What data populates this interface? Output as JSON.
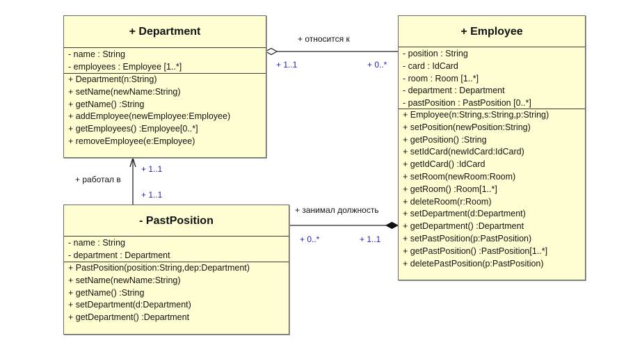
{
  "classes": {
    "department": {
      "name": "+ Department",
      "attributes": [
        "- name : String",
        "- employees : Employee [1..*]"
      ],
      "operations": [
        "+ Department(n:String)",
        "+ setName(newName:String)",
        "+ getName() :String",
        "+ addEmployee(newEmployee:Employee)",
        "+ getEmployees() :Employee[0..*]",
        "+ removeEmployee(e:Employee)"
      ]
    },
    "employee": {
      "name": "+ Employee",
      "attributes": [
        "- position : String",
        "- card : IdCard",
        "- room : Room [1..*]",
        "- department : Department",
        "- pastPosition : PastPosition [0..*]"
      ],
      "operations": [
        "+ Employee(n:String,s:String,p:String)",
        "+ setPosition(newPosition:String)",
        "+ getPosition() :String",
        "+ setIdCard(newIdCard:IdCard)",
        "+ getIdCard() :IdCard",
        "+ setRoom(newRoom:Room)",
        "+ getRoom() :Room[1..*]",
        "+ deleteRoom(r:Room)",
        "+ setDepartment(d:Department)",
        "+ getDepartment() :Department",
        "+ setPastPosition(p:PastPosition)",
        "+ getPastPosition() :PastPosition[1..*]",
        "+ deletePastPosition(p:PastPosition)"
      ]
    },
    "pastposition": {
      "name": "- PastPosition",
      "attributes": [
        "- name : String",
        "- department : Department"
      ],
      "operations": [
        "+ PastPosition(position:String,dep:Department)",
        "+ setName(newName:String)",
        "+ getName() :String",
        "+ setDepartment(d:Department)",
        "+ getDepartment() :Department"
      ]
    }
  },
  "associations": {
    "dept_employee": {
      "kind": "aggregation",
      "label": "+ относится к",
      "source_multiplicity": "+  1..1",
      "target_multiplicity": "+  0..*"
    },
    "pastpos_dept": {
      "kind": "directed-association",
      "label": "+ работал в",
      "source_multiplicity": "+  1..1",
      "target_multiplicity": "+  1..1"
    },
    "pastpos_employee": {
      "kind": "composition",
      "label": "+ занимал должность",
      "source_multiplicity": "+  0..*",
      "target_multiplicity": "+  1..1"
    }
  },
  "colors": {
    "class_fill": "#fffed2",
    "multiplicity_text": "#2222bb"
  }
}
